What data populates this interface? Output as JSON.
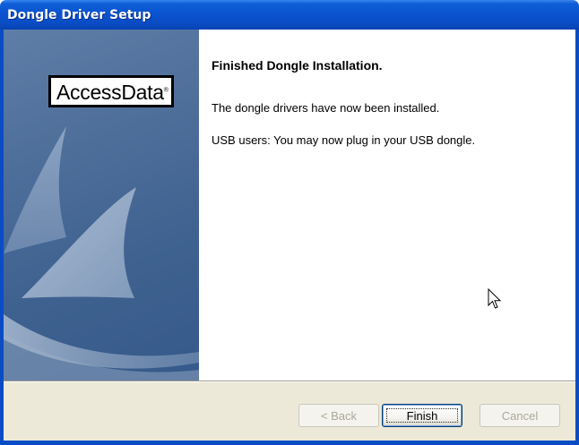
{
  "window": {
    "title": "Dongle Driver Setup"
  },
  "side_panel": {
    "logo_text": "AccessData",
    "logo_mark": "®"
  },
  "content": {
    "heading": "Finished Dongle Installation.",
    "message_1": "The dongle drivers have now been installed.",
    "message_2": "USB users: You may now plug in your USB dongle."
  },
  "buttons": {
    "back": {
      "label": "< Back",
      "enabled": false
    },
    "finish": {
      "label": "Finish",
      "enabled": true,
      "default": true
    },
    "cancel": {
      "label": "Cancel",
      "enabled": false
    }
  },
  "colors": {
    "titlebar": "#0a4cc4",
    "side_panel": "#4e6e9a",
    "button_bar": "#ece9d8"
  },
  "icons": {
    "cursor": "mouse-pointer-icon"
  }
}
